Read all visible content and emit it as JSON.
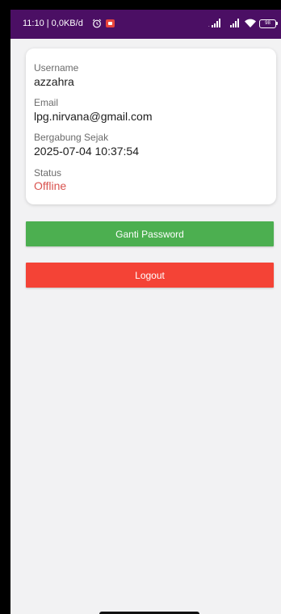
{
  "status_bar": {
    "time_text": "11:10 | 0,0KB/d",
    "battery_level": "98"
  },
  "profile": {
    "username_label": "Username",
    "username_value": "azzahra",
    "email_label": "Email",
    "email_value": "lpg.nirvana@gmail.com",
    "joined_label": "Bergabung Sejak",
    "joined_value": "2025-07-04 10:37:54",
    "status_label": "Status",
    "status_value": "Offline"
  },
  "actions": {
    "change_password_label": "Ganti Password",
    "logout_label": "Logout"
  },
  "colors": {
    "status_bar_bg": "#4b0f64",
    "background": "#f2f2f3",
    "green_button": "#4caf50",
    "red_button": "#f44336",
    "offline_text": "#d9534f"
  }
}
